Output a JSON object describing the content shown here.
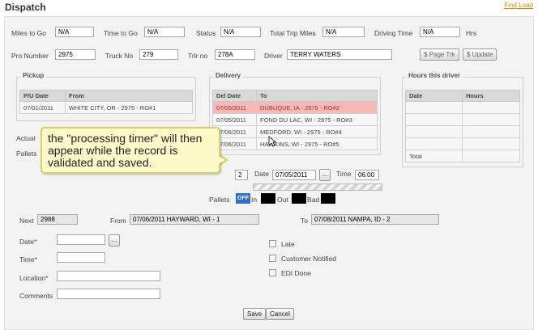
{
  "header": {
    "title": "Dispatch",
    "find_load": "Find Load"
  },
  "row1": {
    "miles_to_go_label": "Miles to Go",
    "miles_to_go": "N/A",
    "time_to_go_label": "Time to Go",
    "time_to_go": "N/A",
    "status_label": "Status",
    "status": "N/A",
    "total_trip_miles_label": "Total Trip Miles",
    "total_trip_miles": "N/A",
    "driving_time_label": "Driving Time",
    "driving_time": "N/A",
    "hrs_label": "Hrs"
  },
  "row2": {
    "pro_number_label": "Pro Number",
    "pro_number": "2975",
    "truck_no_label": "Truck No",
    "truck_no": "279",
    "trlr_no_label": "Trlr no",
    "trlr_no": "278A",
    "driver_label": "Driver",
    "driver": "TERRY WATERS",
    "page_trk_button": "$ Page Trk",
    "update_button": "$ Update"
  },
  "pickup": {
    "legend": "Pickup",
    "headers": [
      "P/U Date",
      "From"
    ],
    "rows": [
      [
        "07/01/2011",
        "WHITE CITY, OR - 2975 - RO#1"
      ]
    ]
  },
  "delivery": {
    "legend": "Delivery",
    "headers": [
      "Del Date",
      "To"
    ],
    "rows": [
      [
        "07/05/2011",
        "DUBUQUE, IA - 2975 - RO#2"
      ],
      [
        "07/05/2011",
        "FOND DU LAC, WI - 2975 - RO#3"
      ],
      [
        "07/06/2011",
        "MEDFORD, WI - 2975 - RO#4"
      ],
      [
        "07/06/2011",
        "HAWKINS, WI - 2975 - RO#5"
      ]
    ]
  },
  "hours": {
    "legend": "Hours this driver",
    "headers": [
      "Date",
      "Hours"
    ],
    "total_label": "Total"
  },
  "left_labels": {
    "actual": "Actual",
    "pallets": "Pallets"
  },
  "mid": {
    "stop_value": "2",
    "date_label": "Date",
    "date_value": "07/05/2011",
    "time_label": "Time",
    "time_value": "06:00"
  },
  "pallets_row": {
    "label": "Pallets",
    "off": "OFF",
    "in": "In",
    "out": "Out",
    "bad": "Bad"
  },
  "tooltip": {
    "text": "the \"processing timer\" will then appear while the record is validated and saved."
  },
  "next_row": {
    "next_label": "Next",
    "next_value": "2988",
    "from_label": "From",
    "from_value": "07/06/2011 HAYWARD, WI - 1",
    "to_label": "To",
    "to_value": "07/08/2011 NAMPA, ID - 2"
  },
  "form": {
    "date_label": "Date*",
    "time_label": "Time*",
    "location_label": "Location*",
    "comments_label": "Comments",
    "picker_button": "..."
  },
  "checks": {
    "late": "Late",
    "customer_notified": "Customer Notified",
    "edi_done": "EDI Done"
  },
  "actions": {
    "save": "Save",
    "cancel": "Cancel"
  }
}
